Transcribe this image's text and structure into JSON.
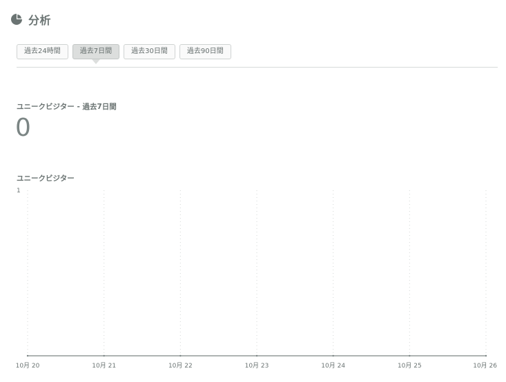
{
  "header": {
    "title": "分析",
    "icon": "pie-chart-icon"
  },
  "tabs": [
    {
      "label": "過去24時間",
      "active": false
    },
    {
      "label": "過去7日間",
      "active": true
    },
    {
      "label": "過去30日間",
      "active": false
    },
    {
      "label": "過去90日間",
      "active": false
    }
  ],
  "summary": {
    "label": "ユニークビジター - 過去7日間",
    "value": "0"
  },
  "chart_title": "ユニークビジター",
  "chart_data": {
    "type": "line",
    "title": "ユニークビジター",
    "categories": [
      "10月 20",
      "10月 21",
      "10月 22",
      "10月 23",
      "10月 24",
      "10月 25",
      "10月 26"
    ],
    "series": [
      {
        "values": [
          0,
          0,
          0,
          0,
          0,
          0,
          0
        ]
      }
    ],
    "ylim": [
      0,
      1
    ],
    "y_ticks": [
      "1"
    ],
    "grid": "vertical-dotted",
    "colors": {
      "axis": "#bfc4c3",
      "grid": "#d3d7d6",
      "line": "#7b8584"
    }
  }
}
